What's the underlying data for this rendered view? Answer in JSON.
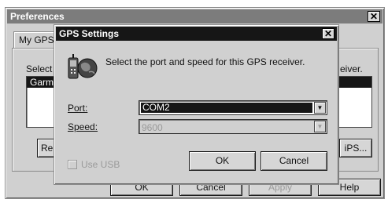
{
  "preferences": {
    "title": "Preferences",
    "tab_label": "My GPS",
    "select_text": "Select",
    "receiver_text": "eiver.",
    "list_item": "Garmin",
    "left_button_partial": "Rer",
    "right_button_partial": "iPS...",
    "ok_label": "OK",
    "cancel_label": "Cancel",
    "apply_label": "Apply",
    "help_label": "Help"
  },
  "gps_settings": {
    "title": "GPS Settings",
    "instruction": "Select the port and speed for this GPS receiver.",
    "port_label": "Port:",
    "port_value": "COM2",
    "speed_label": "Speed:",
    "speed_value": "9600",
    "use_usb_label": "Use USB",
    "use_usb_checked": false,
    "ok_label": "OK",
    "cancel_label": "Cancel"
  },
  "icons": {
    "close": "close-icon",
    "gps_receiver": "gps-receiver-icon",
    "dropdown_arrow": "chevron-down-icon"
  }
}
